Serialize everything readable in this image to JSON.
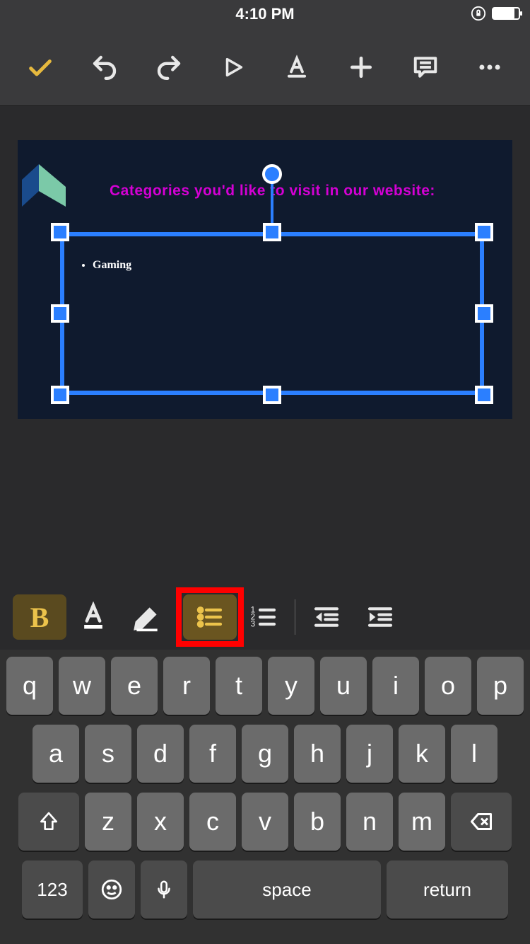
{
  "status": {
    "time": "4:10 PM"
  },
  "toolbar": {
    "confirm": "check-icon",
    "undo": "undo-icon",
    "redo": "redo-icon",
    "play": "play-icon",
    "text_style": "text-format-icon",
    "add": "plus-icon",
    "comment": "comment-icon",
    "more": "more-icon"
  },
  "slide": {
    "title": "Categories you'd like to visit in our website:",
    "bullets": [
      "Gaming"
    ]
  },
  "format_bar": {
    "bold_label": "B"
  },
  "keyboard": {
    "row1": [
      "q",
      "w",
      "e",
      "r",
      "t",
      "y",
      "u",
      "i",
      "o",
      "p"
    ],
    "row2": [
      "a",
      "s",
      "d",
      "f",
      "g",
      "h",
      "j",
      "k",
      "l"
    ],
    "row3": [
      "z",
      "x",
      "c",
      "v",
      "b",
      "n",
      "m"
    ],
    "numbers": "123",
    "space": "space",
    "return": "return"
  }
}
